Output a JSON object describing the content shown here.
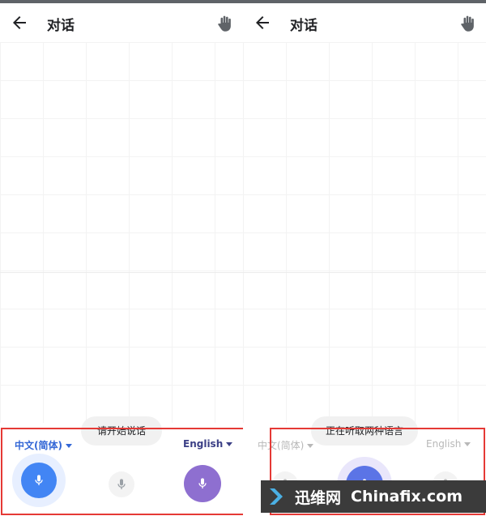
{
  "left_screen": {
    "header": {
      "title": "对话",
      "back_icon": "arrow-back-icon",
      "hand_icon": "hand-icon"
    },
    "toast": "请开始说话",
    "source_language": "中文(简体)",
    "target_language": "English",
    "buttons": {
      "left_mic": "mic-icon",
      "center_mic": "mic-icon",
      "right_mic": "mic-icon"
    }
  },
  "right_screen": {
    "header": {
      "title": "对话",
      "back_icon": "arrow-back-icon",
      "hand_icon": "hand-icon"
    },
    "toast": "正在听取两种语言",
    "source_language": "中文(简体)",
    "target_language": "English",
    "buttons": {
      "left_mic": "mic-icon",
      "center_mic": "mic-icon",
      "right_mic": "mic-icon"
    }
  },
  "watermark": {
    "brand_cn": "迅维网",
    "brand_en": "Chinafix.com"
  },
  "colors": {
    "blue": "#4285f4",
    "purple": "#8e6fd0",
    "highlight": "#e53935",
    "lang_blue": "#3367d6"
  }
}
